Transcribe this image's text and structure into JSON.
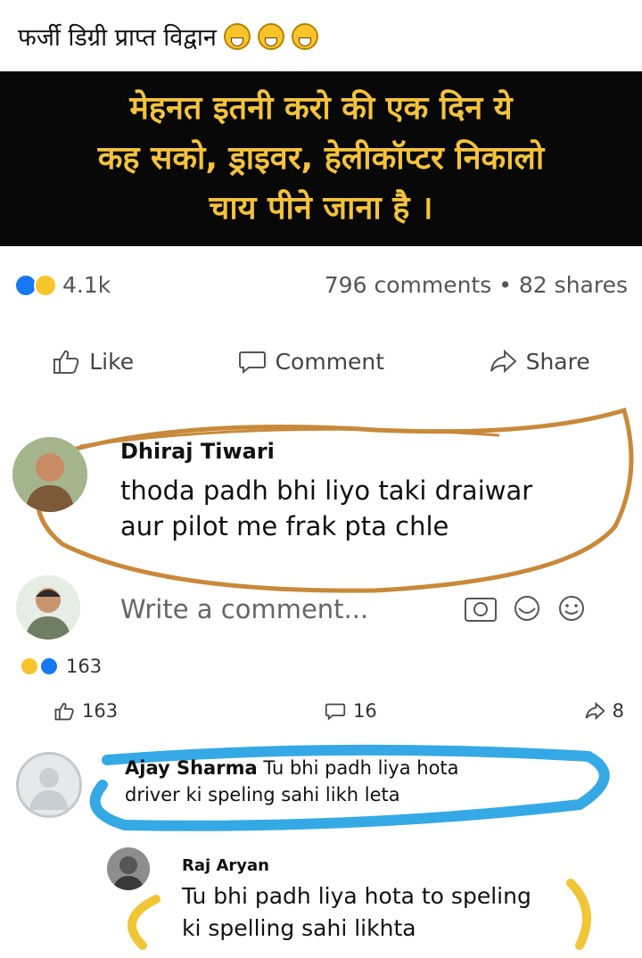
{
  "caption": {
    "text": "फर्जी डिग्री प्राप्त विद्वान",
    "emojis": [
      "grin-icon",
      "laugh-tears-icon",
      "smile-icon"
    ]
  },
  "banner": {
    "lines": [
      "मेहनत इतनी करो की एक दिन ये",
      "कह सको, ड्राइवर, हेलीकॉप्टर निकालो",
      "चाय पीने जाना है ।"
    ],
    "background": "#080808",
    "text_color": "#f4c33b"
  },
  "post_stats": {
    "reactions_count": "4.1k",
    "comments": "796 comments",
    "separator": "•",
    "shares": "82 shares"
  },
  "actions": {
    "like": "Like",
    "comment": "Comment",
    "share": "Share"
  },
  "comment_1": {
    "author": "Dhiraj Tiwari",
    "lines": [
      "thoda padh bhi liyo taki draiwar",
      "aur pilot me frak pta chle"
    ]
  },
  "write_comment": {
    "placeholder": "Write a comment..."
  },
  "comment_stats": {
    "reactions": "163",
    "likes": "163",
    "replies": "16",
    "shares": "8"
  },
  "reply_1": {
    "author": "Ajay Sharma",
    "text": "Tu bhi padh liya hota",
    "line2": "driver ki speling sahi likh leta"
  },
  "reply_2": {
    "author": "Raj Aryan",
    "lines": [
      "Tu bhi padh liya hota to speling",
      "ki spelling sahi likhta"
    ]
  },
  "colors": {
    "accent_blue": "#1877f2",
    "highlight_orange": "#c9893a",
    "highlight_blue": "#35a9e5",
    "highlight_yellow": "#f0c636"
  }
}
